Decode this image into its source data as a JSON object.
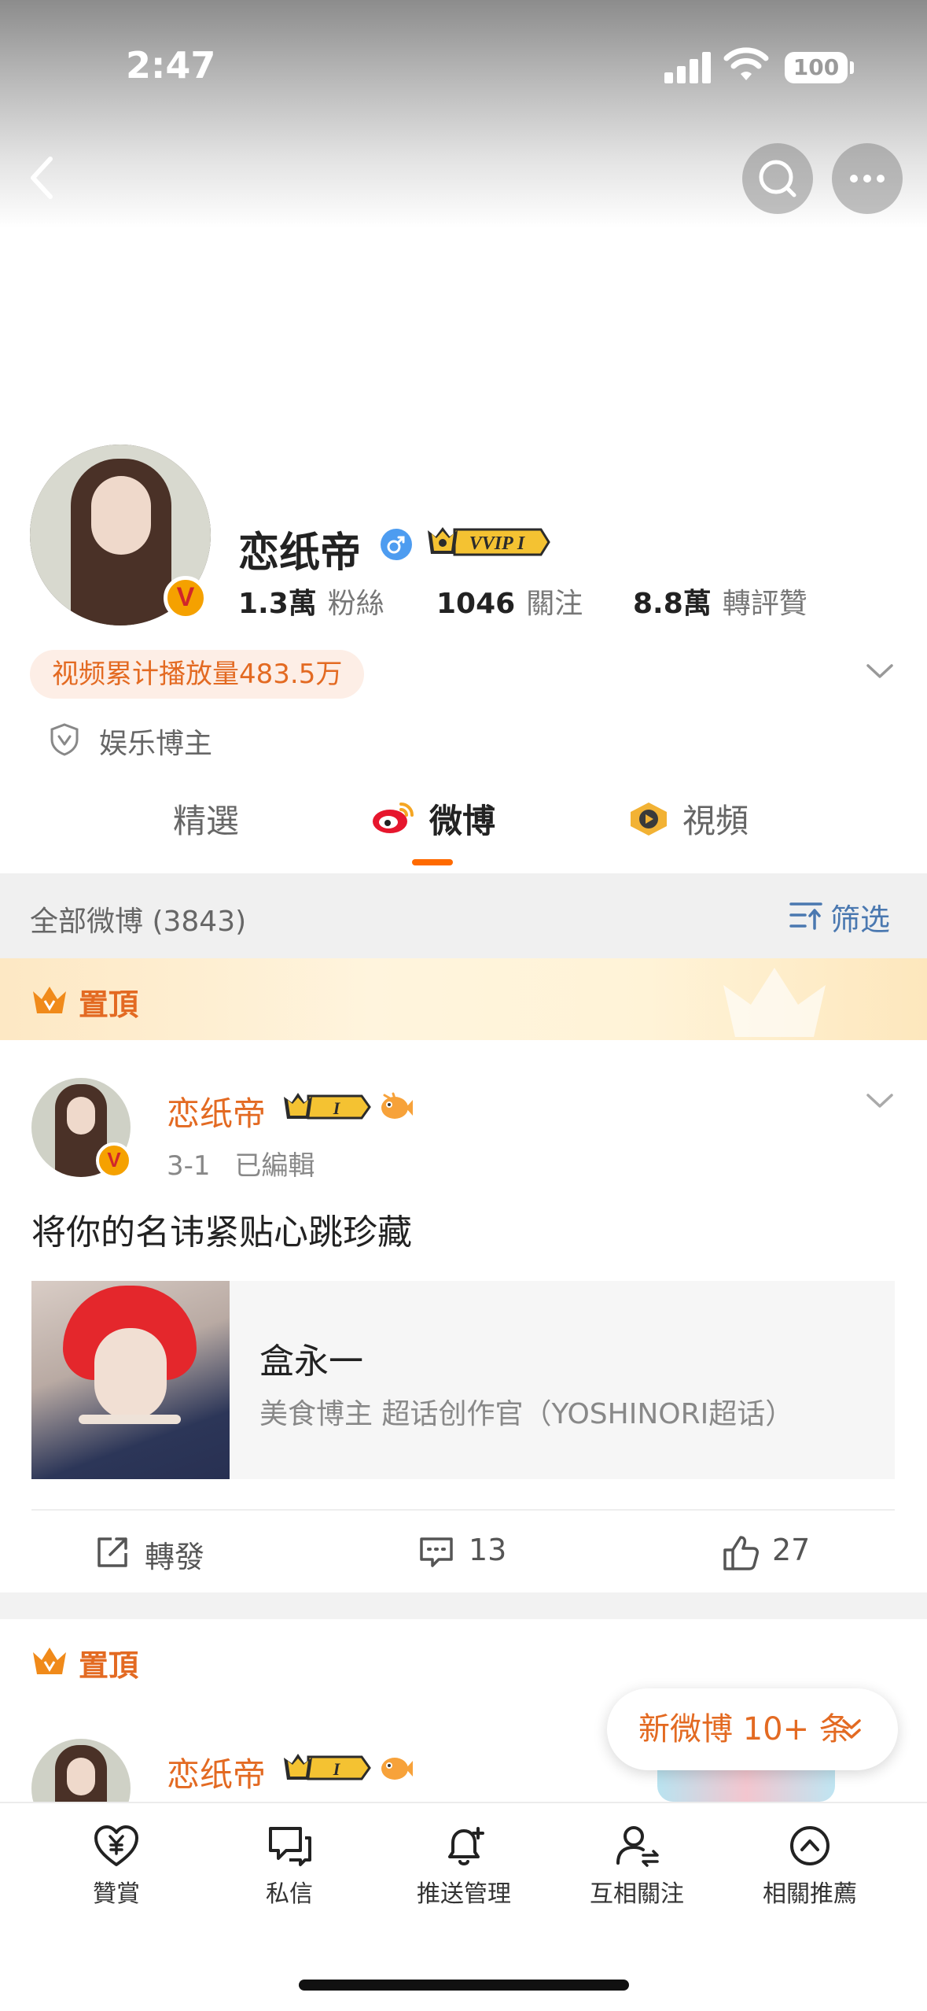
{
  "status_bar": {
    "time": "2:47",
    "battery": "100"
  },
  "profile": {
    "name": "恋纸帝",
    "vip_badge": "VVIP I",
    "stats": [
      {
        "value": "1.3萬",
        "label": "粉絲"
      },
      {
        "value": "1046",
        "label": "關注"
      },
      {
        "value": "8.8萬",
        "label": "轉評贊"
      }
    ],
    "video_plays": "视频累计播放量483.5万",
    "verification": "娱乐博主"
  },
  "tabs": [
    {
      "label": "精選",
      "active": false
    },
    {
      "label": "微博",
      "active": true
    },
    {
      "label": "視頻",
      "active": false
    }
  ],
  "filter": {
    "count_label": "全部微博 (3843)",
    "filter_label": "筛选"
  },
  "pinned_label": "置頂",
  "posts": [
    {
      "author": "恋纸帝",
      "level_badge": "I",
      "date": "3-1",
      "edited": "已編輯",
      "text": "将你的名讳紧贴心跳珍藏",
      "card": {
        "title": "盒永一",
        "subtitle": "美食博主 超话创作官（YOSHINORI超话）"
      },
      "actions": {
        "repost": "轉發",
        "comments": "13",
        "likes": "27"
      }
    },
    {
      "author": "恋纸帝",
      "level_badge": "I"
    }
  ],
  "new_posts": "新微博 10+ 条",
  "bottom_nav": [
    {
      "label": "贊賞",
      "icon": "heart-yen-icon"
    },
    {
      "label": "私信",
      "icon": "chat-bubble-icon"
    },
    {
      "label": "推送管理",
      "icon": "bell-plus-icon"
    },
    {
      "label": "互相關注",
      "icon": "user-follow-icon"
    },
    {
      "label": "相關推薦",
      "icon": "circle-up-icon"
    }
  ],
  "colors": {
    "accent": "#E36A22",
    "tab_indicator": "#FF6A00",
    "filter_blue": "#4A78B0",
    "gender_blue": "#4D9CF0"
  }
}
